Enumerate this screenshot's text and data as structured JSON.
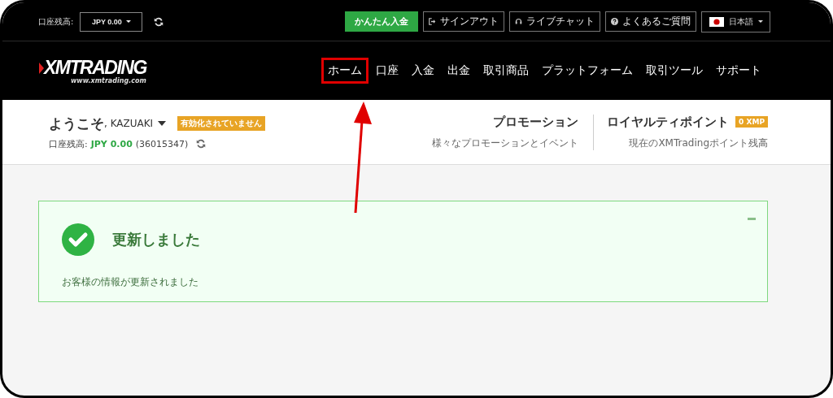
{
  "top_bar": {
    "balance_label": "口座残高:",
    "balance_select": "JPY 0.00",
    "deposit_button": "かんたん入金",
    "buttons": [
      {
        "kind": "signout",
        "label": "サインアウト"
      },
      {
        "kind": "chat",
        "label": "ライブチャット"
      },
      {
        "kind": "faq",
        "label": "よくあるご質問"
      }
    ],
    "language": "日本語"
  },
  "logo": {
    "name": "XMTRADING",
    "url": "www.xmtrading.com"
  },
  "nav": [
    {
      "label": "ホーム",
      "highlighted": true
    },
    {
      "label": "口座",
      "highlighted": false
    },
    {
      "label": "入金",
      "highlighted": false
    },
    {
      "label": "出金",
      "highlighted": false
    },
    {
      "label": "取引商品",
      "highlighted": false
    },
    {
      "label": "プラットフォーム",
      "highlighted": false
    },
    {
      "label": "取引ツール",
      "highlighted": false
    },
    {
      "label": "サポート",
      "highlighted": false
    }
  ],
  "welcome": {
    "greeting": "ようこそ",
    "user": ", KAZUAKI",
    "status_badge": "有効化されていません",
    "balance_label": "口座残高:",
    "balance": "JPY 0.00",
    "account": "(36015347)"
  },
  "promotion": {
    "title": "プロモーション",
    "subtitle": "様々なプロモーションとイベント"
  },
  "loyalty": {
    "title": "ロイヤルティポイント",
    "badge": "0 XMP",
    "subtitle": "現在のXMTradingポイント残高"
  },
  "alert": {
    "title": "更新しました",
    "message": "お客様の情報が更新されました"
  }
}
